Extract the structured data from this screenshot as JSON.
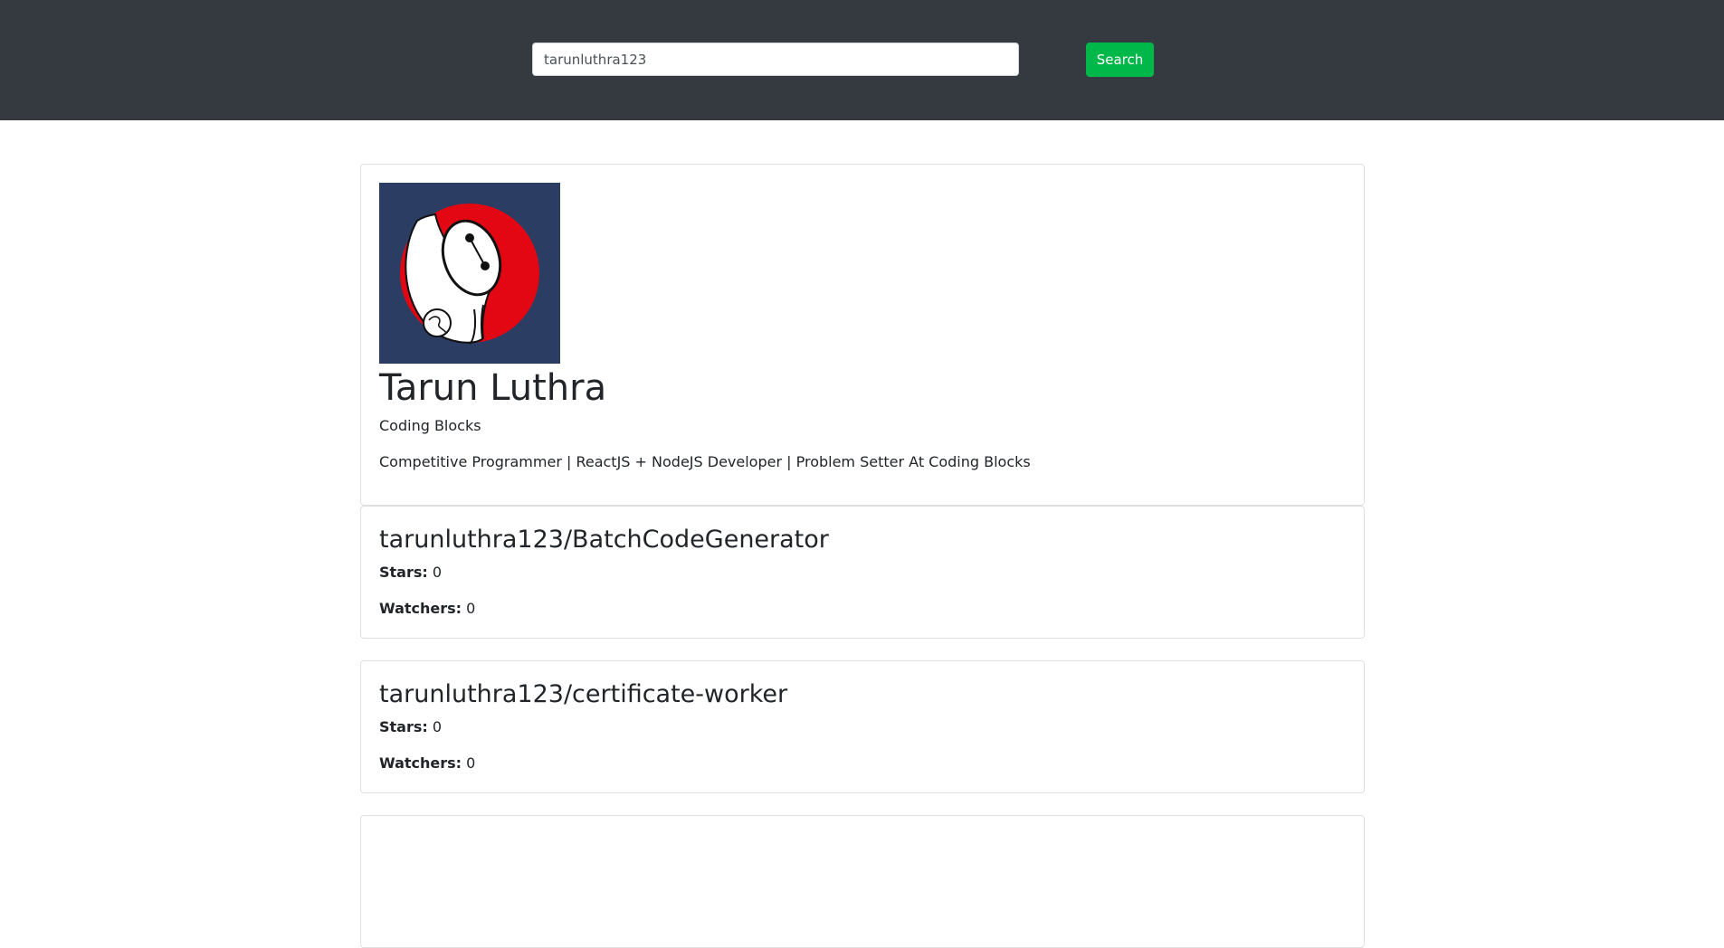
{
  "search": {
    "value": "tarunluthra123",
    "button_label": "Search"
  },
  "profile": {
    "name": "Tarun Luthra",
    "company": "Coding Blocks",
    "bio": "Competitive Programmer | ReactJS + NodeJS Developer | Problem Setter At Coding Blocks",
    "avatar_icon": "baymax-avatar-icon"
  },
  "repos": [
    {
      "full_name": "tarunluthra123/BatchCodeGenerator",
      "stars_label": "Stars:",
      "stars": "0",
      "watchers_label": "Watchers:",
      "watchers": "0"
    },
    {
      "full_name": "tarunluthra123/certificate-worker",
      "stars_label": "Stars:",
      "stars": "0",
      "watchers_label": "Watchers:",
      "watchers": "0"
    },
    {
      "full_name": "",
      "stars_label": "",
      "stars": "",
      "watchers_label": "",
      "watchers": ""
    }
  ],
  "colors": {
    "topbar": "#343a40",
    "search_button": "#00b74a",
    "avatar_bg": "#2b3d63",
    "avatar_red": "#e30613"
  }
}
